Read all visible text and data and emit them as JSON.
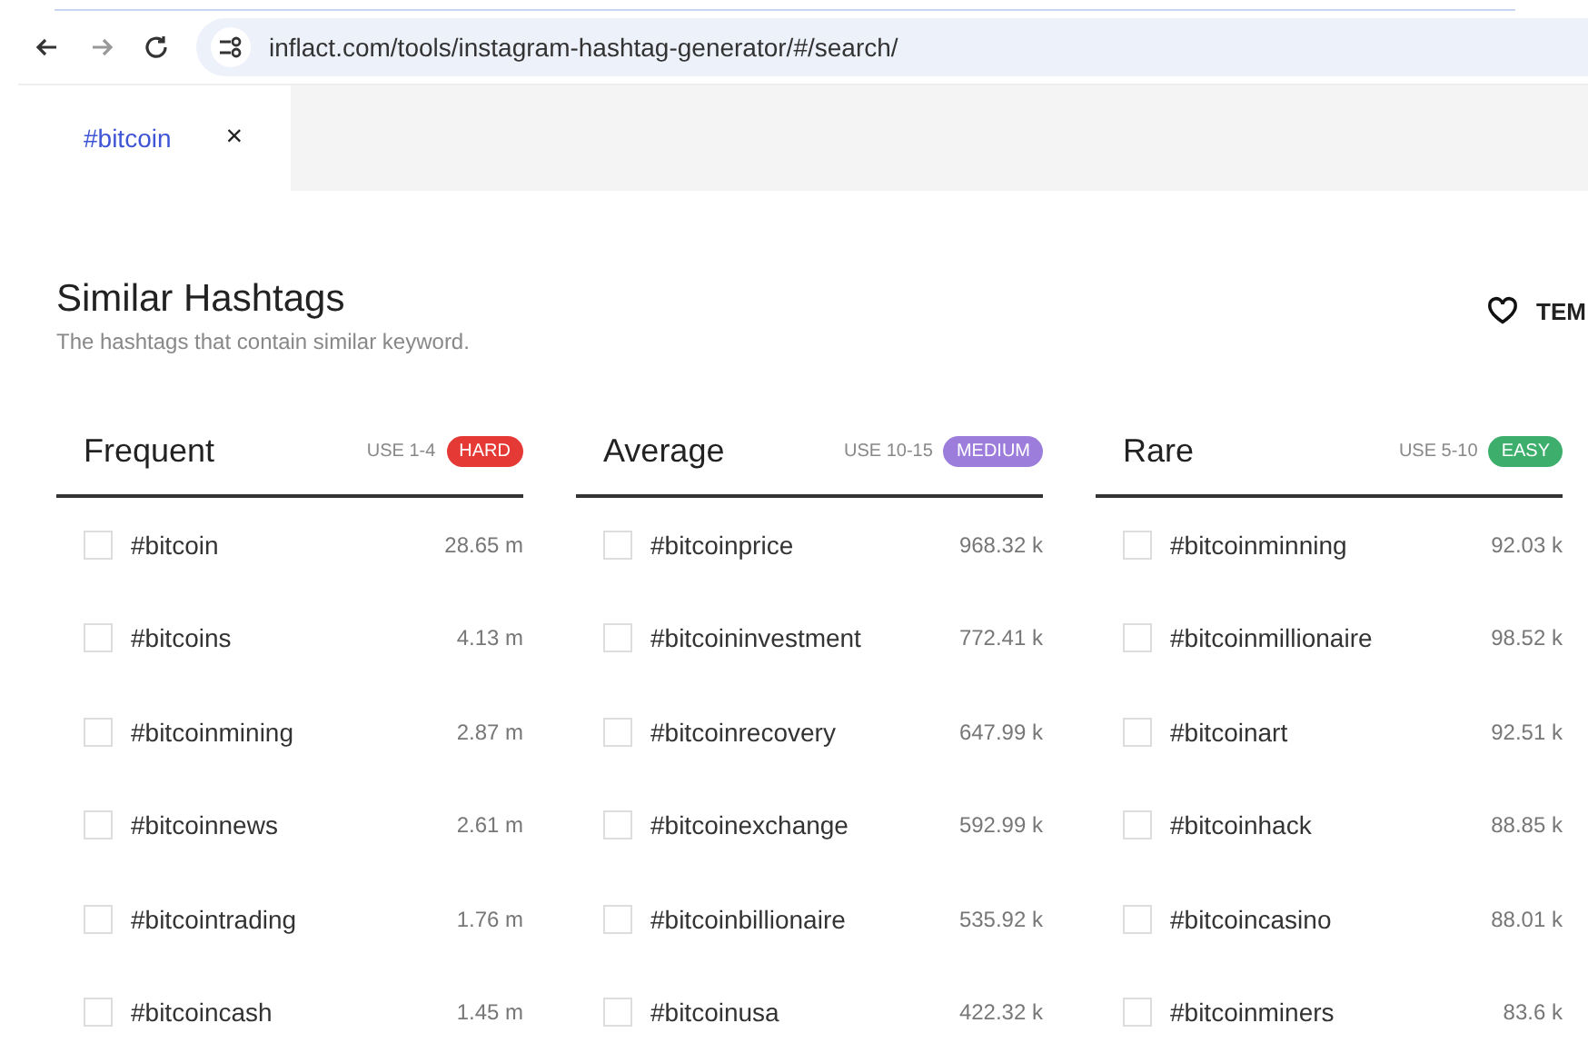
{
  "browser": {
    "url": "inflact.com/tools/instagram-hashtag-generator/#/search/"
  },
  "tabs": [
    {
      "label": "#bitcoin",
      "close": "×"
    }
  ],
  "section": {
    "title": "Similar Hashtags",
    "subtitle": "The hashtags that contain similar keyword.",
    "action": "TEM"
  },
  "columns": [
    {
      "title": "Frequent",
      "use": "USE 1-4",
      "badge": "HARD",
      "color": "#e53935",
      "rows": [
        {
          "tag": "#bitcoin",
          "count": "28.65 m",
          "checked": false
        },
        {
          "tag": "#bitcoins",
          "count": "4.13 m",
          "checked": false
        },
        {
          "tag": "#bitcoinmining",
          "count": "2.87 m",
          "checked": false
        },
        {
          "tag": "#bitcoinnews",
          "count": "2.61 m",
          "checked": false
        },
        {
          "tag": "#bitcointrading",
          "count": "1.76 m",
          "checked": false
        },
        {
          "tag": "#bitcoincash",
          "count": "1.45 m",
          "checked": false
        }
      ]
    },
    {
      "title": "Average",
      "use": "USE 10-15",
      "badge": "MEDIUM",
      "color": "#9c7ddb",
      "rows": [
        {
          "tag": "#bitcoinprice",
          "count": "968.32 k",
          "checked": false
        },
        {
          "tag": "#bitcoininvestment",
          "count": "772.41 k",
          "checked": false
        },
        {
          "tag": "#bitcoinrecovery",
          "count": "647.99 k",
          "checked": false
        },
        {
          "tag": "#bitcoinexchange",
          "count": "592.99 k",
          "checked": false
        },
        {
          "tag": "#bitcoinbillionaire",
          "count": "535.92 k",
          "checked": false
        },
        {
          "tag": "#bitcoinusa",
          "count": "422.32 k",
          "checked": false
        }
      ]
    },
    {
      "title": "Rare",
      "use": "USE 5-10",
      "badge": "EASY",
      "color": "#3dae6b",
      "rows": [
        {
          "tag": "#bitcoinminning",
          "count": "92.03 k",
          "checked": false
        },
        {
          "tag": "#bitcoinmillionaire",
          "count": "98.52 k",
          "checked": false
        },
        {
          "tag": "#bitcoinart",
          "count": "92.51 k",
          "checked": false
        },
        {
          "tag": "#bitcoinhack",
          "count": "88.85 k",
          "checked": false
        },
        {
          "tag": "#bitcoincasino",
          "count": "88.01 k",
          "checked": false
        },
        {
          "tag": "#bitcoinminers",
          "count": "83.6 k",
          "checked": false
        }
      ]
    }
  ]
}
